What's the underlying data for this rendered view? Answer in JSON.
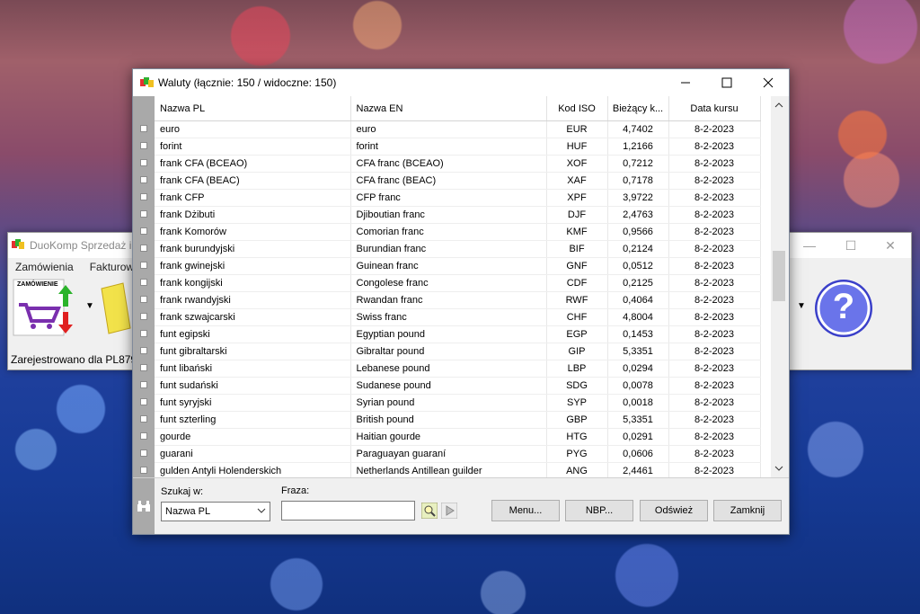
{
  "background_window": {
    "title": "DuoKomp Sprzedaż i I",
    "menu": [
      "Zamówienia",
      "Fakturowa"
    ],
    "order_icon_label": "ZAMÓWIENIE",
    "status": "Zarejestrowano dla PL8792",
    "help_glyph": "?"
  },
  "window": {
    "title": "Waluty (łącznie: 150 / widoczne: 150)"
  },
  "table": {
    "columns": [
      "Nazwa PL",
      "Nazwa EN",
      "Kod ISO",
      "Bieżący k...",
      "Data kursu"
    ],
    "rows": [
      [
        "euro",
        "euro",
        "EUR",
        "4,7402",
        "8-2-2023"
      ],
      [
        "forint",
        "forint",
        "HUF",
        "1,2166",
        "8-2-2023"
      ],
      [
        "frank CFA (BCEAO)",
        "CFA franc (BCEAO)",
        "XOF",
        "0,7212",
        "8-2-2023"
      ],
      [
        "frank CFA (BEAC)",
        "CFA franc (BEAC)",
        "XAF",
        "0,7178",
        "8-2-2023"
      ],
      [
        "frank CFP",
        "CFP franc",
        "XPF",
        "3,9722",
        "8-2-2023"
      ],
      [
        "frank Dżibuti",
        "Djiboutian franc",
        "DJF",
        "2,4763",
        "8-2-2023"
      ],
      [
        "frank Komorów",
        "Comorian franc",
        "KMF",
        "0,9566",
        "8-2-2023"
      ],
      [
        "frank burundyjski",
        "Burundian franc",
        "BIF",
        "0,2124",
        "8-2-2023"
      ],
      [
        "frank gwinejski",
        "Guinean franc",
        "GNF",
        "0,0512",
        "8-2-2023"
      ],
      [
        "frank kongijski",
        "Congolese franc",
        "CDF",
        "0,2125",
        "8-2-2023"
      ],
      [
        "frank rwandyjski",
        "Rwandan franc",
        "RWF",
        "0,4064",
        "8-2-2023"
      ],
      [
        "frank szwajcarski",
        "Swiss franc",
        "CHF",
        "4,8004",
        "8-2-2023"
      ],
      [
        "funt egipski",
        "Egyptian pound",
        "EGP",
        "0,1453",
        "8-2-2023"
      ],
      [
        "funt gibraltarski",
        "Gibraltar pound",
        "GIP",
        "5,3351",
        "8-2-2023"
      ],
      [
        "funt libański",
        "Lebanese pound",
        "LBP",
        "0,0294",
        "8-2-2023"
      ],
      [
        "funt sudański",
        "Sudanese pound",
        "SDG",
        "0,0078",
        "8-2-2023"
      ],
      [
        "funt syryjski",
        "Syrian pound",
        "SYP",
        "0,0018",
        "8-2-2023"
      ],
      [
        "funt szterling",
        "British pound",
        "GBP",
        "5,3351",
        "8-2-2023"
      ],
      [
        "gourde",
        "Haitian gourde",
        "HTG",
        "0,0291",
        "8-2-2023"
      ],
      [
        "guarani",
        "Paraguayan guaraní",
        "PYG",
        "0,0606",
        "8-2-2023"
      ],
      [
        "gulden Antyli Holenderskich",
        "Netherlands Antillean guilder",
        "ANG",
        "2,4461",
        "8-2-2023"
      ]
    ]
  },
  "search": {
    "search_in_label": "Szukaj w:",
    "search_in_value": "Nazwa PL",
    "phrase_label": "Fraza:",
    "phrase_value": ""
  },
  "buttons": {
    "menu": "Menu...",
    "nbp": "NBP...",
    "refresh": "Odśwież",
    "close": "Zamknij"
  }
}
